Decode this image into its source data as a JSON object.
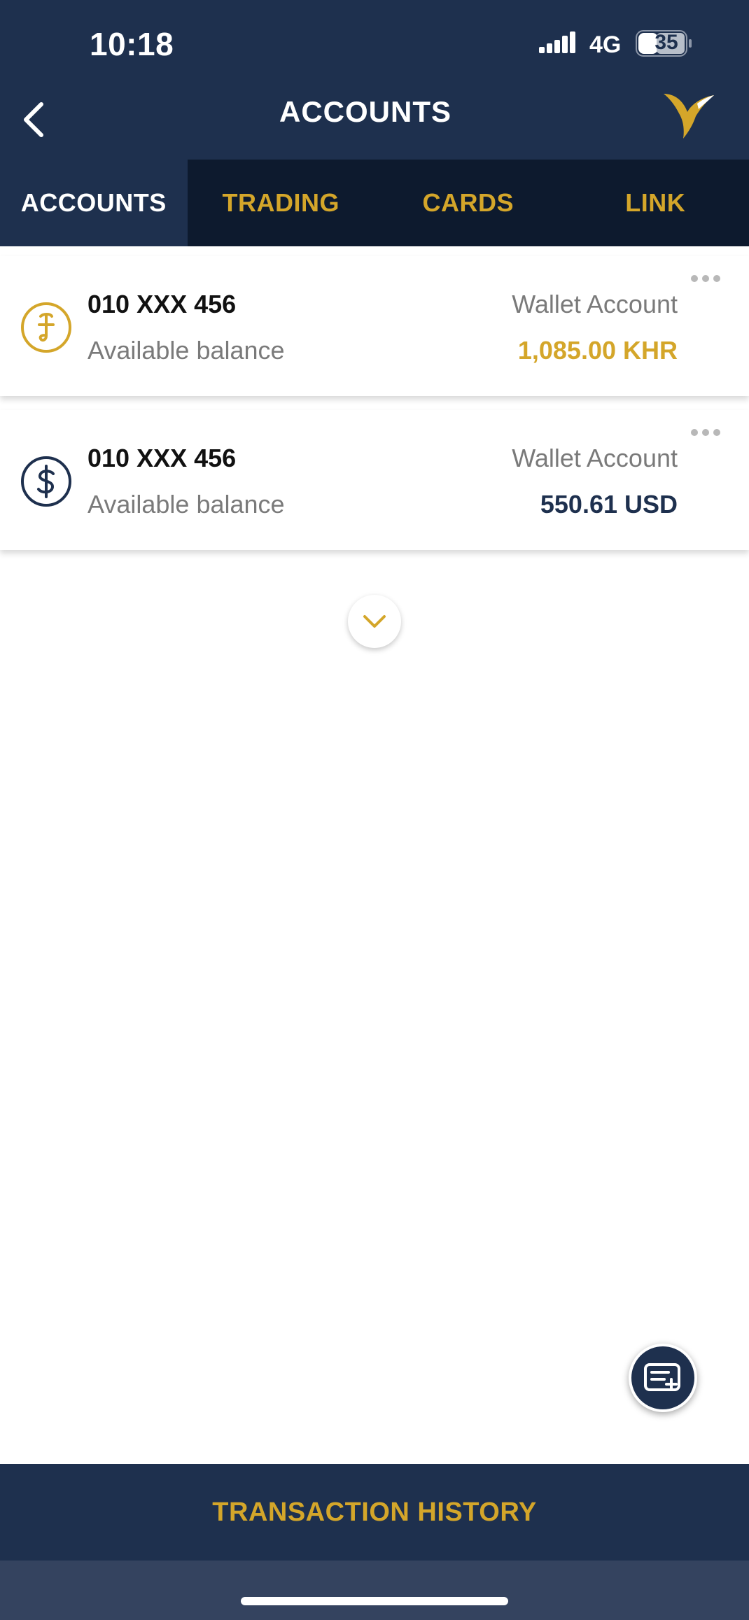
{
  "status_bar": {
    "time": "10:18",
    "network": "4G",
    "battery": "35"
  },
  "header": {
    "title": "ACCOUNTS",
    "back_icon": "chevron-left-icon",
    "logo_icon": "bird-logo-icon"
  },
  "tabs": [
    {
      "label": "ACCOUNTS",
      "active": true
    },
    {
      "label": "TRADING",
      "active": false
    },
    {
      "label": "CARDS",
      "active": false
    },
    {
      "label": "LINK",
      "active": false
    }
  ],
  "accounts": [
    {
      "icon": "riel-currency-icon",
      "number": "010 XXX 456",
      "balance_label": "Available balance",
      "type": "Wallet Account",
      "balance": "1,085.00 KHR"
    },
    {
      "icon": "dollar-currency-icon",
      "number": "010 XXX 456",
      "balance_label": "Available balance",
      "type": "Wallet Account",
      "balance": "550.61 USD"
    }
  ],
  "footer": {
    "transaction_history": "TRANSACTION HISTORY"
  },
  "colors": {
    "navy": "#1e304e",
    "dark_navy": "#0d1a2e",
    "gold": "#d4a62a"
  }
}
